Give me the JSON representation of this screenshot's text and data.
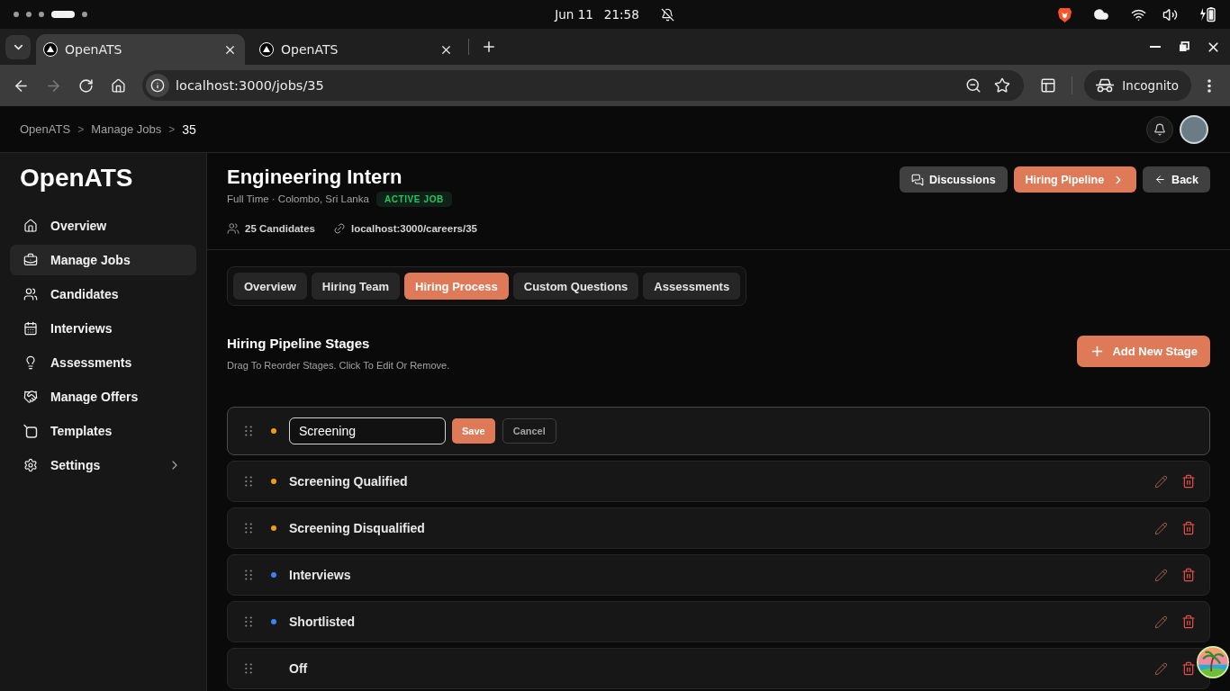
{
  "system_bar": {
    "date": "Jun 11",
    "time": "21:58"
  },
  "browser": {
    "tabs": [
      {
        "title": "OpenATS",
        "selected": true
      },
      {
        "title": "OpenATS",
        "selected": false
      }
    ],
    "forward_disabled": true,
    "address": "localhost:3000/jobs/35",
    "profile": "Incognito"
  },
  "breadcrumb": [
    {
      "label": "OpenATS",
      "separator": ">",
      "current": false
    },
    {
      "label": "Manage Jobs",
      "separator": ">",
      "current": false
    },
    {
      "label": "35",
      "current": true
    }
  ],
  "sidebar": {
    "logo": "OpenATS",
    "items": [
      {
        "label": "Overview",
        "selected": false,
        "has_submenu": false
      },
      {
        "label": "Manage Jobs",
        "selected": true,
        "has_submenu": false
      },
      {
        "label": "Candidates",
        "selected": false,
        "has_submenu": false
      },
      {
        "label": "Interviews",
        "selected": false,
        "has_submenu": false
      },
      {
        "label": "Assessments",
        "selected": false,
        "has_submenu": false
      },
      {
        "label": "Manage Offers",
        "selected": false,
        "has_submenu": false
      },
      {
        "label": "Templates",
        "selected": false,
        "has_submenu": false
      },
      {
        "label": "Settings",
        "selected": false,
        "has_submenu": true
      }
    ]
  },
  "job": {
    "title": "Engineering Intern",
    "details": "Full Time · Colombo, Sri Lanka",
    "status": "ACTIVE JOB",
    "candidates": "25 Candidates",
    "careers_link": "localhost:3000/careers/35"
  },
  "actions": [
    {
      "label": "Discussions",
      "kind": "secondary"
    },
    {
      "label": "Hiring Pipeline",
      "kind": "primary"
    },
    {
      "label": "Back",
      "kind": "secondary"
    }
  ],
  "tabs": [
    {
      "label": "Overview",
      "selected": false
    },
    {
      "label": "Hiring Team",
      "selected": false
    },
    {
      "label": "Hiring Process",
      "selected": true
    },
    {
      "label": "Custom Questions",
      "selected": false
    },
    {
      "label": "Assessments",
      "selected": false
    }
  ],
  "stages_section": {
    "title": "Hiring Pipeline Stages",
    "subtitle": "Drag To Reorder Stages. Click To Edit Or Remove.",
    "add_button": "Add New Stage"
  },
  "stages": [
    {
      "name": "Screening",
      "color": "#f59e0b",
      "editing": true,
      "save_label": "Save",
      "cancel_label": "Cancel"
    },
    {
      "name": "Screening Qualified",
      "color": "#f59e0b",
      "editing": false
    },
    {
      "name": "Screening Disqualified",
      "color": "#f59e0b",
      "editing": false
    },
    {
      "name": "Interviews",
      "color": "#3b82f6",
      "editing": false
    },
    {
      "name": "Shortlisted",
      "color": "#3b82f6",
      "editing": false
    },
    {
      "name": "Off",
      "editing": false
    }
  ]
}
